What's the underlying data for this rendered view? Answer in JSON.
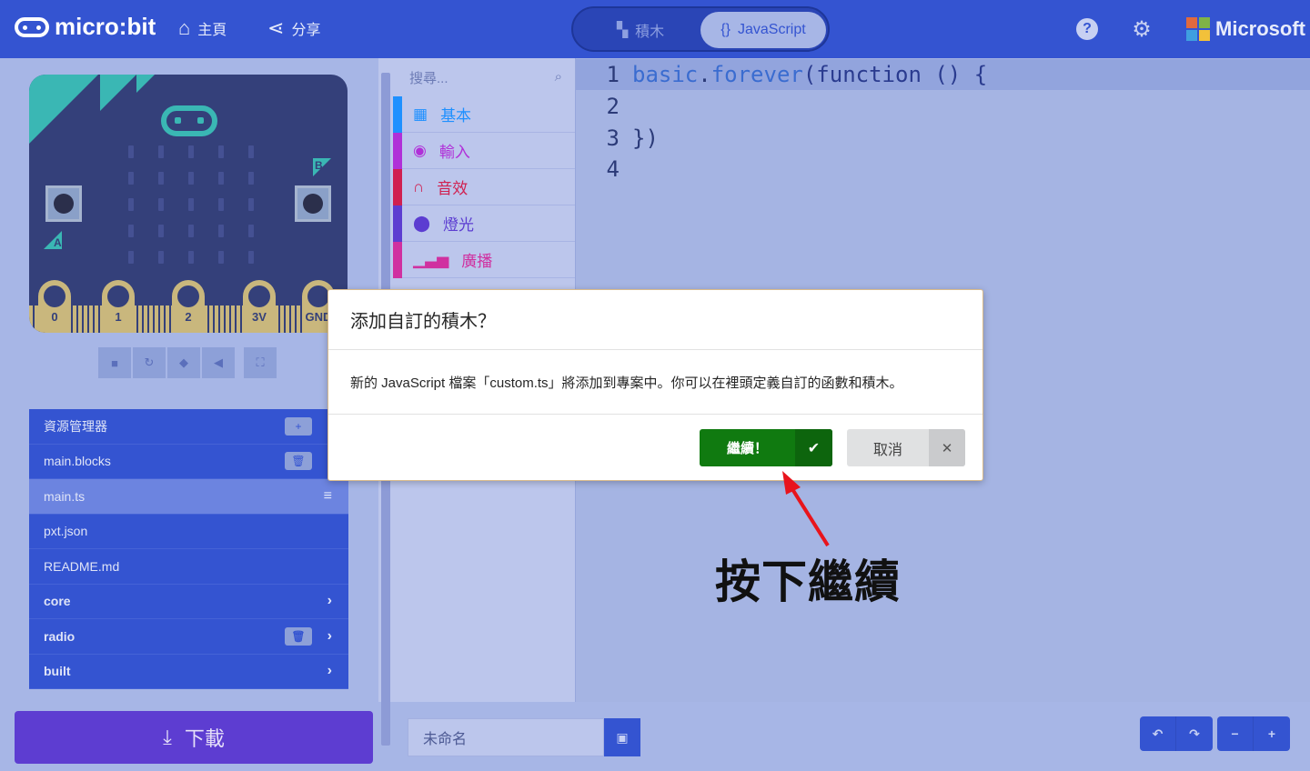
{
  "header": {
    "logo_text": "micro:bit",
    "home_label": "主頁",
    "share_label": "分享",
    "mode_tabs": {
      "blocks": "積木",
      "javascript": "JavaScript"
    },
    "microsoft_label": "Microsoft",
    "help_glyph": "?",
    "settings_glyph": "⚙"
  },
  "simulator": {
    "button_a": "A",
    "button_b": "B",
    "pins": [
      "0",
      "1",
      "2",
      "3V",
      "GND"
    ],
    "tools": [
      "stop-icon",
      "restart-icon",
      "slowmo-icon",
      "mute-icon",
      "fullscreen-icon"
    ]
  },
  "explorer": {
    "title": "資源管理器",
    "files": [
      {
        "label": "main.blocks"
      },
      {
        "label": "main.ts"
      },
      {
        "label": "pxt.json"
      },
      {
        "label": "README.md"
      },
      {
        "label": "core"
      },
      {
        "label": "radio"
      },
      {
        "label": "built"
      }
    ]
  },
  "download_label": "下載",
  "toolbox": {
    "search_placeholder": "搜尋...",
    "categories": [
      {
        "label": "基本",
        "color": "#1e90ff",
        "icon": "grid-icon"
      },
      {
        "label": "輸入",
        "color": "#b030d8",
        "icon": "target-icon"
      },
      {
        "label": "音效",
        "color": "#d02050",
        "icon": "headphones-icon"
      },
      {
        "label": "燈光",
        "color": "#5c3dd1",
        "icon": "toggle-icon"
      },
      {
        "label": "廣播",
        "color": "#d030a0",
        "icon": "signal-icon"
      }
    ]
  },
  "editor": {
    "lines": [
      {
        "num": "1",
        "part1": "basic",
        "part2": ".",
        "part3": "forever",
        "part4": "(function () {"
      },
      {
        "num": "2",
        "part1": "",
        "part2": "",
        "part3": "",
        "part4": ""
      },
      {
        "num": "3",
        "part1": "",
        "part2": "",
        "part3": "",
        "part4": "})"
      },
      {
        "num": "4",
        "part1": "",
        "part2": "",
        "part3": "",
        "part4": ""
      }
    ]
  },
  "project_name": "未命名",
  "dialog": {
    "title": "添加自訂的積木？",
    "body": "新的 JavaScript 檔案「custom.ts」將添加到專案中。你可以在裡頭定義自訂的函數和積木。",
    "continue_label": "繼續！",
    "cancel_label": "取消"
  },
  "annotation": {
    "callout_text": "按下繼續",
    "arrow_color": "#e8141c"
  }
}
